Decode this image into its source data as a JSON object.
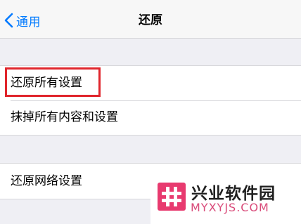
{
  "navbar": {
    "back_label": "通用",
    "title": "还原"
  },
  "settings": {
    "group1": {
      "items": [
        {
          "label": "还原所有设置"
        },
        {
          "label": "抹掉所有内容和设置"
        }
      ]
    },
    "group2": {
      "items": [
        {
          "label": "还原网络设置"
        }
      ]
    }
  },
  "watermark": {
    "site_name": "兴业软件园",
    "url": "MYXYJS.COM"
  },
  "colors": {
    "accent": "#007aff",
    "highlight": "#e0252c",
    "watermark_logo": "#e83a6f"
  }
}
